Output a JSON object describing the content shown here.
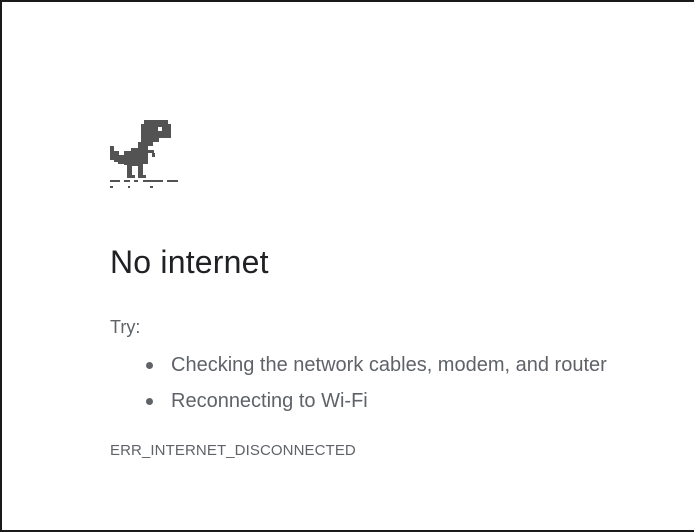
{
  "error_page": {
    "icon": "offline-dino-icon",
    "title": "No internet",
    "try_label": "Try:",
    "suggestions": [
      "Checking the network cables, modem, and router",
      "Reconnecting to Wi-Fi"
    ],
    "error_code": "ERR_INTERNET_DISCONNECTED"
  },
  "colors": {
    "title": "#202124",
    "body_text": "#5f6368",
    "dino": "#535353",
    "background": "#ffffff"
  }
}
